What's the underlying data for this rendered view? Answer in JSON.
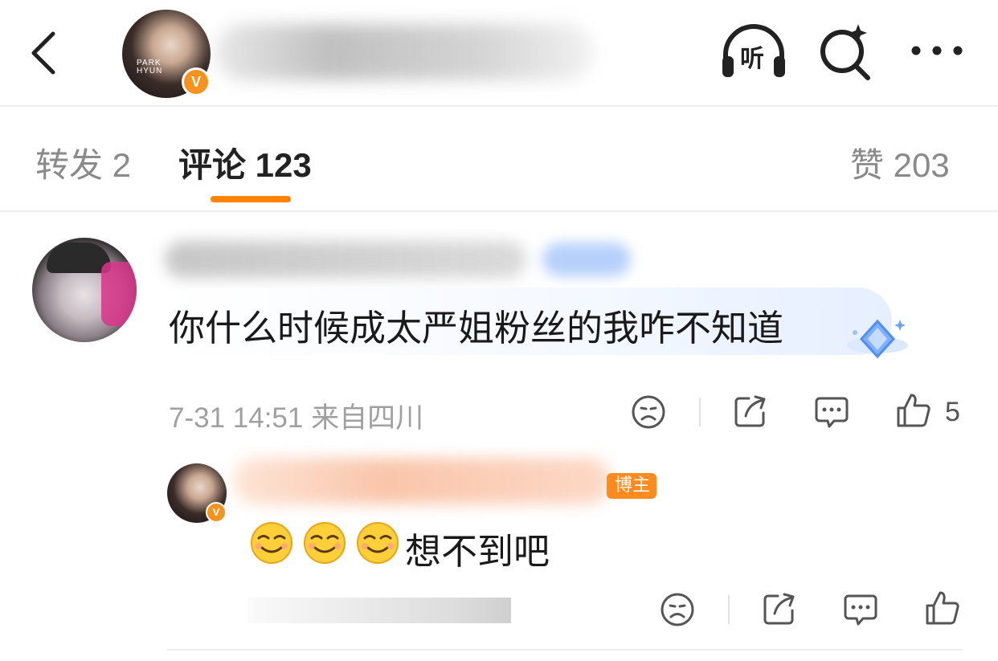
{
  "header": {
    "back_icon": "chevron-left-icon",
    "avatar_text": "PARK\nHYUN",
    "verified_badge": "V",
    "listen_label": "听",
    "colors": {
      "accent": "#ff8200",
      "verified": "#f7921e"
    }
  },
  "tabs": [
    {
      "label": "转发 2",
      "active": false
    },
    {
      "label": "评论 123",
      "active": true
    },
    {
      "label": "赞 203",
      "active": false
    }
  ],
  "comment": {
    "text": "你什么时候成太严姐粉丝的我咋不知道",
    "meta": "7-31 14:51 来自四川",
    "like_count": "5",
    "actions": [
      "dislike-icon",
      "share-icon",
      "comment-icon",
      "like-icon"
    ]
  },
  "reply": {
    "author_tag": "博主",
    "emoji_icons": [
      "smirk-emoji-icon",
      "smirk-emoji-icon",
      "smirk-emoji-icon"
    ],
    "text": "想不到吧",
    "actions": [
      "dislike-icon",
      "share-icon",
      "comment-icon",
      "like-icon"
    ]
  }
}
